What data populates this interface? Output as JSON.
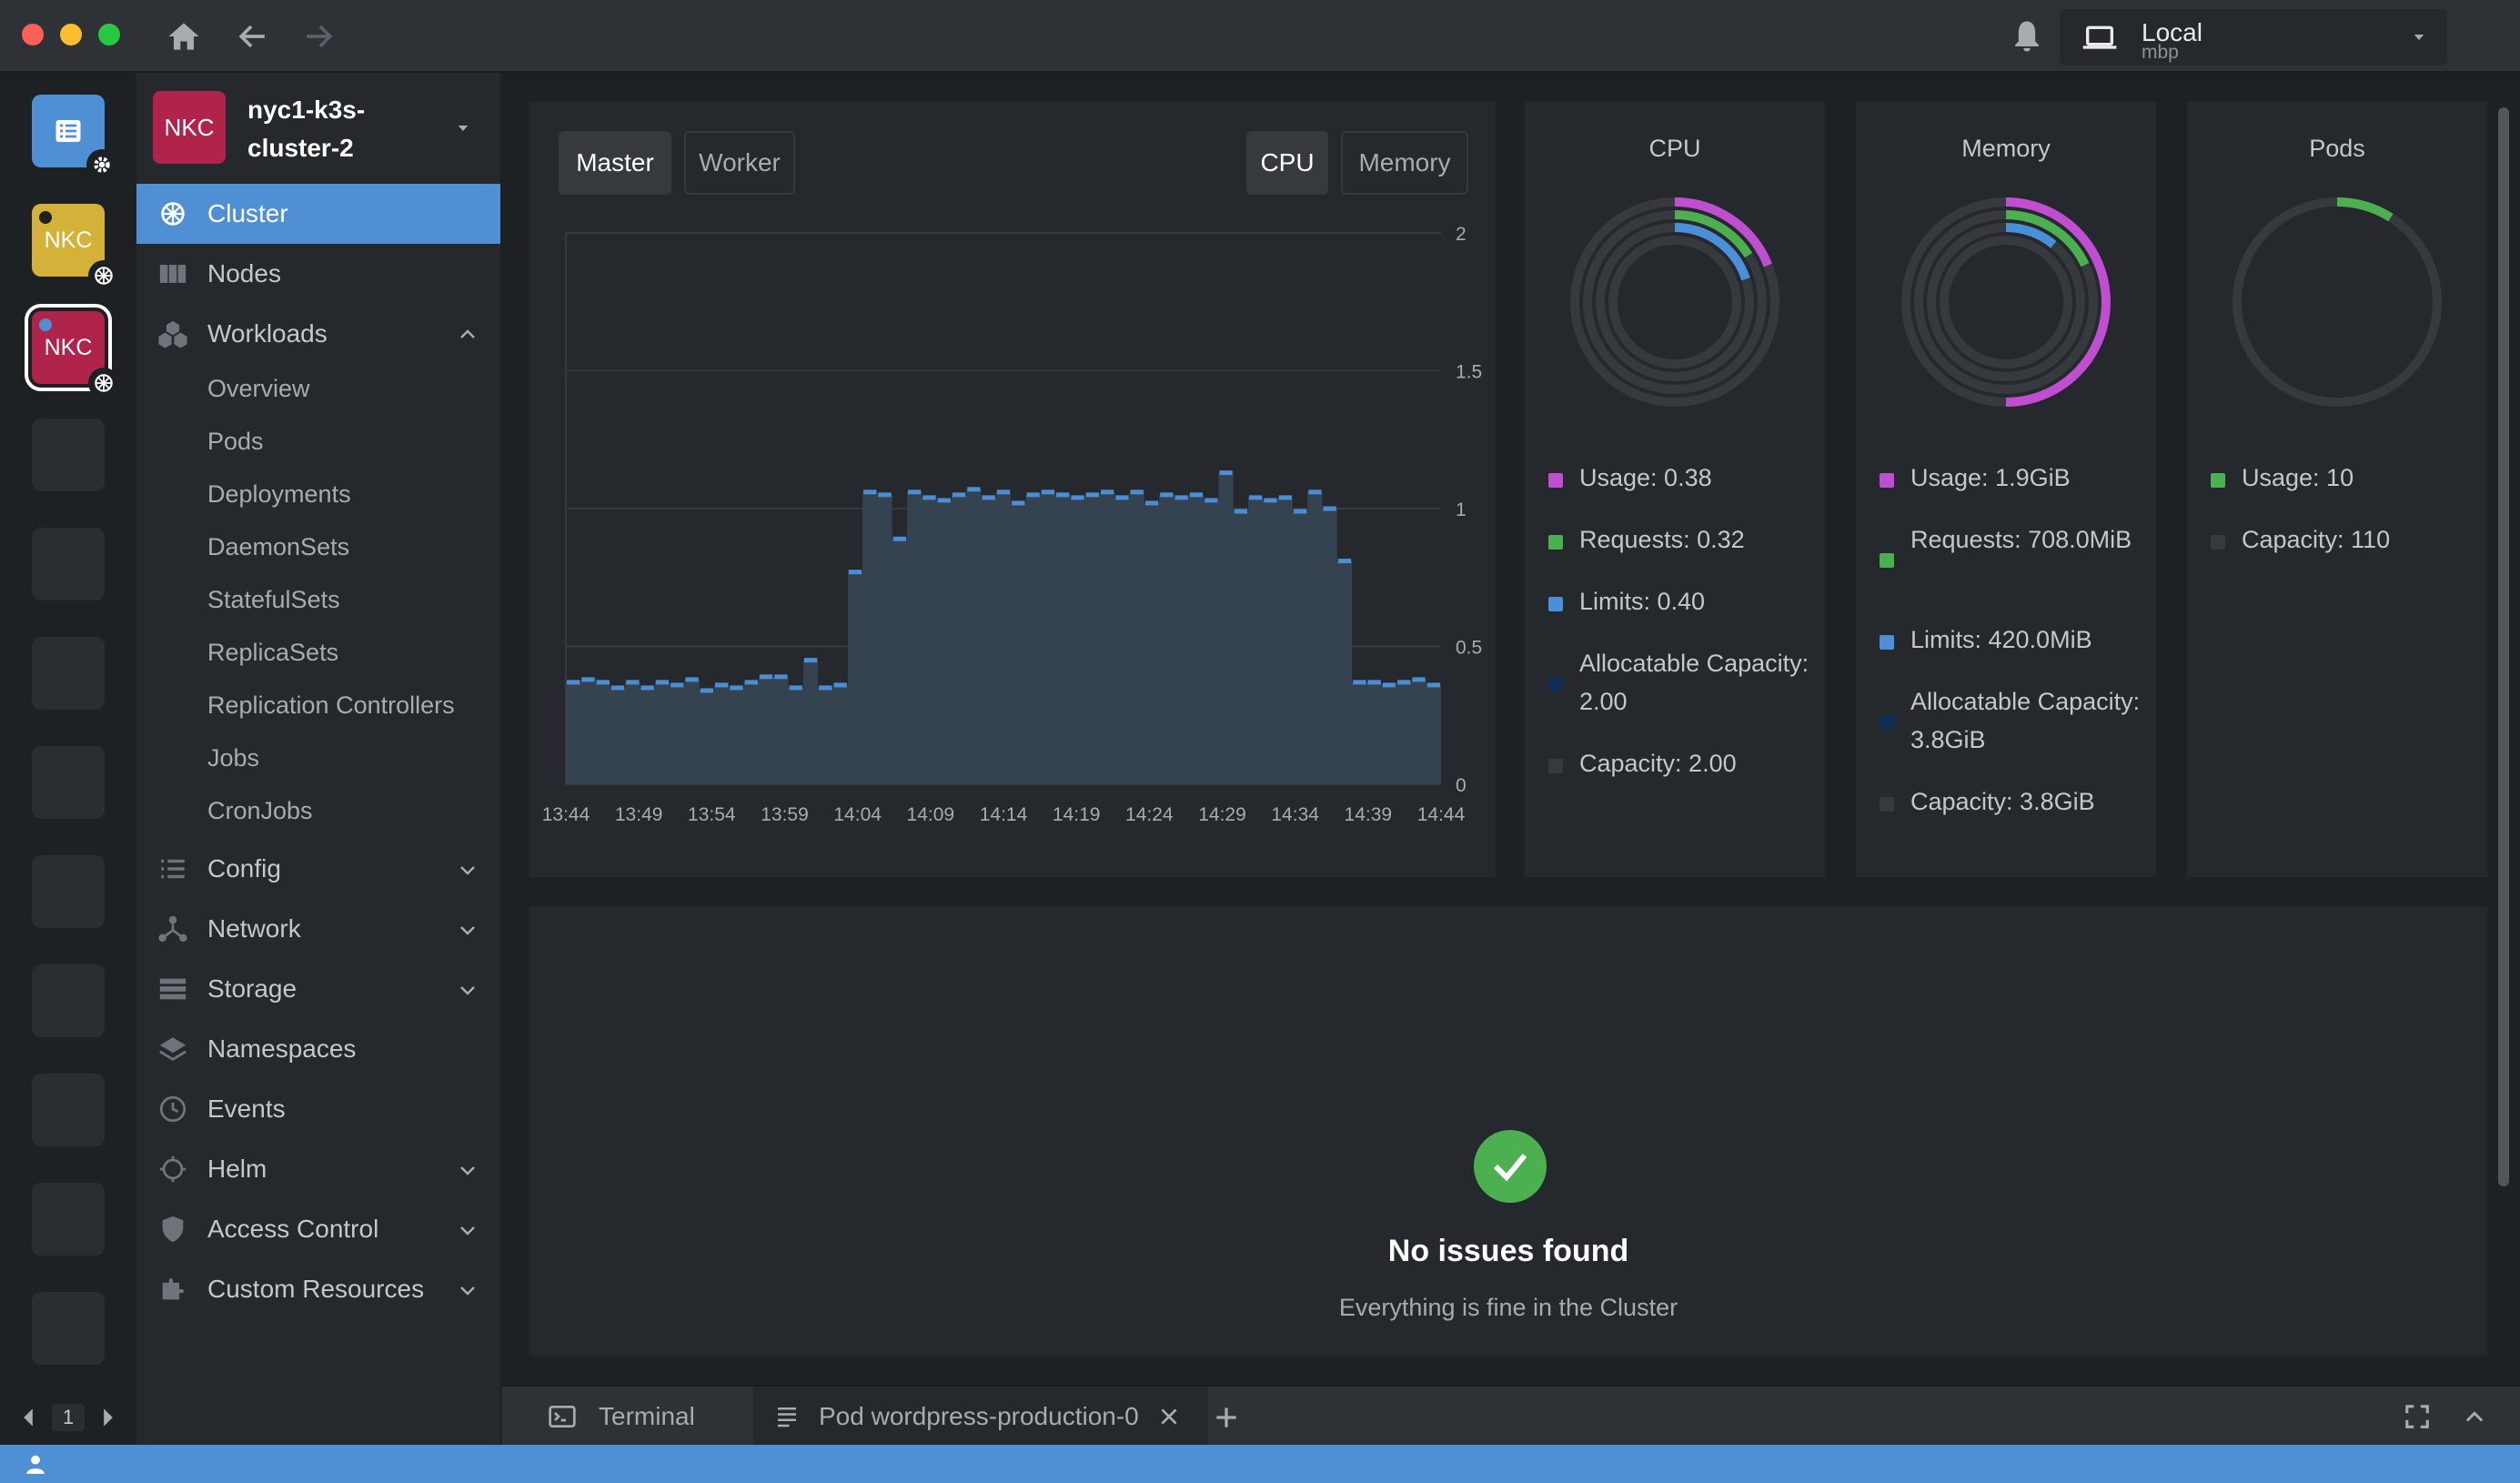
{
  "titlebar": {
    "context_title": "Local",
    "context_subtitle": "mbp"
  },
  "hotbar": {
    "items": [
      {
        "label": "NKC",
        "color": "#d4b23a"
      },
      {
        "label": "NKC",
        "color": "#b0244b"
      }
    ],
    "page": "1"
  },
  "cluster": {
    "avatar": "NKC",
    "name": "nyc1-k3s-cluster-2"
  },
  "sidebar": {
    "cluster": "Cluster",
    "nodes": "Nodes",
    "workloads": "Workloads",
    "workloads_items": [
      "Overview",
      "Pods",
      "Deployments",
      "DaemonSets",
      "StatefulSets",
      "ReplicaSets",
      "Replication Controllers",
      "Jobs",
      "CronJobs"
    ],
    "config": "Config",
    "network": "Network",
    "storage": "Storage",
    "namespaces": "Namespaces",
    "events": "Events",
    "helm": "Helm",
    "access_control": "Access Control",
    "custom_resources": "Custom Resources"
  },
  "metrics": {
    "tabs": [
      "Master",
      "Worker"
    ],
    "active_tab": "Master",
    "type_tabs": [
      "CPU",
      "Memory"
    ],
    "active_type": "CPU"
  },
  "chart_data": {
    "type": "area",
    "x_ticks": [
      "13:44",
      "13:49",
      "13:54",
      "13:59",
      "14:04",
      "14:09",
      "14:14",
      "14:19",
      "14:24",
      "14:29",
      "14:34",
      "14:39",
      "14:44"
    ],
    "y_ticks": [
      "2",
      "1.5",
      "1",
      "0.5",
      "0"
    ],
    "ylim": [
      0,
      2
    ],
    "series": [
      {
        "values": [
          0.37,
          0.38,
          0.37,
          0.35,
          0.37,
          0.35,
          0.37,
          0.36,
          0.38,
          0.34,
          0.36,
          0.35,
          0.37,
          0.39,
          0.39,
          0.35,
          0.45,
          0.35,
          0.36,
          0.77,
          1.06,
          1.05,
          0.89,
          1.06,
          1.04,
          1.03,
          1.05,
          1.07,
          1.04,
          1.06,
          1.02,
          1.05,
          1.06,
          1.05,
          1.04,
          1.05,
          1.06,
          1.04,
          1.06,
          1.02,
          1.05,
          1.04,
          1.05,
          1.03,
          1.13,
          0.99,
          1.04,
          1.03,
          1.04,
          0.99,
          1.06,
          1.0,
          0.81,
          0.37,
          0.37,
          0.36,
          0.37,
          0.38,
          0.36
        ]
      }
    ],
    "colors": {
      "line": "#4a8fd6",
      "fill": "#354351"
    },
    "grid": true
  },
  "cards": {
    "cpu": {
      "title": "CPU",
      "legend": [
        "Usage: 0.38",
        "Requests: 0.32",
        "Limits: 0.40",
        "Allocatable Capacity: 2.00",
        "Capacity: 2.00"
      ],
      "ring_fractions": [
        0.19,
        0.16,
        0.2
      ]
    },
    "memory": {
      "title": "Memory",
      "legend": [
        "Usage: 1.9GiB",
        "Requests: 708.0MiB",
        "Limits: 420.0MiB",
        "Allocatable Capacity: 3.8GiB",
        "Capacity: 3.8GiB"
      ],
      "ring_fractions": [
        0.5,
        0.18,
        0.11
      ]
    },
    "pods": {
      "title": "Pods",
      "legend": [
        "Usage: 10",
        "Capacity: 110"
      ],
      "ring_fractions": [
        0.09
      ]
    }
  },
  "legend_colors": {
    "usage": "#c04ed0",
    "requests": "#4caf50",
    "limits": "#4a90d9",
    "allocatable": "#0f2d52",
    "capacity": "#36393e"
  },
  "issues": {
    "title": "No issues found",
    "subtitle": "Everything is fine in the Cluster"
  },
  "dock": {
    "terminal": "Terminal",
    "pod_tab": "Pod wordpress-production-0"
  }
}
